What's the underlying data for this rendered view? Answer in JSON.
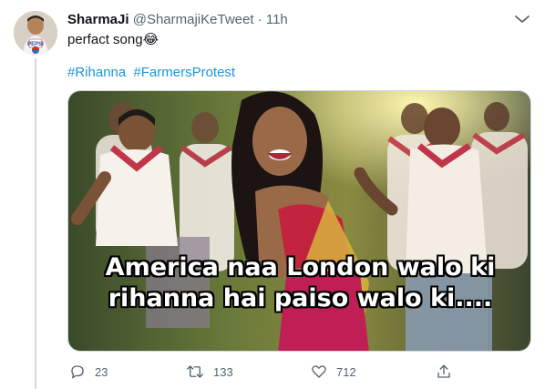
{
  "tweet": {
    "author_name": "SharmaJi",
    "handle": "@SharmajiKeTweet",
    "separator": "·",
    "time": "11h",
    "text": "perfact song",
    "emoji": "😂",
    "hashtags": [
      "#Rihanna",
      "#FarmersProtest"
    ]
  },
  "media": {
    "caption_line1": "America naa London walo ki",
    "caption_line2": "rihanna hai paiso walo ki...."
  },
  "actions": {
    "reply_count": "23",
    "retweet_count": "133",
    "like_count": "712"
  },
  "icons": {
    "more": "more-icon",
    "reply": "reply-icon",
    "retweet": "retweet-icon",
    "like": "heart-icon",
    "share": "share-icon"
  },
  "colors": {
    "accent": "#1b95e0",
    "muted": "#536471",
    "avatar_badge": "#2f6fbd"
  }
}
